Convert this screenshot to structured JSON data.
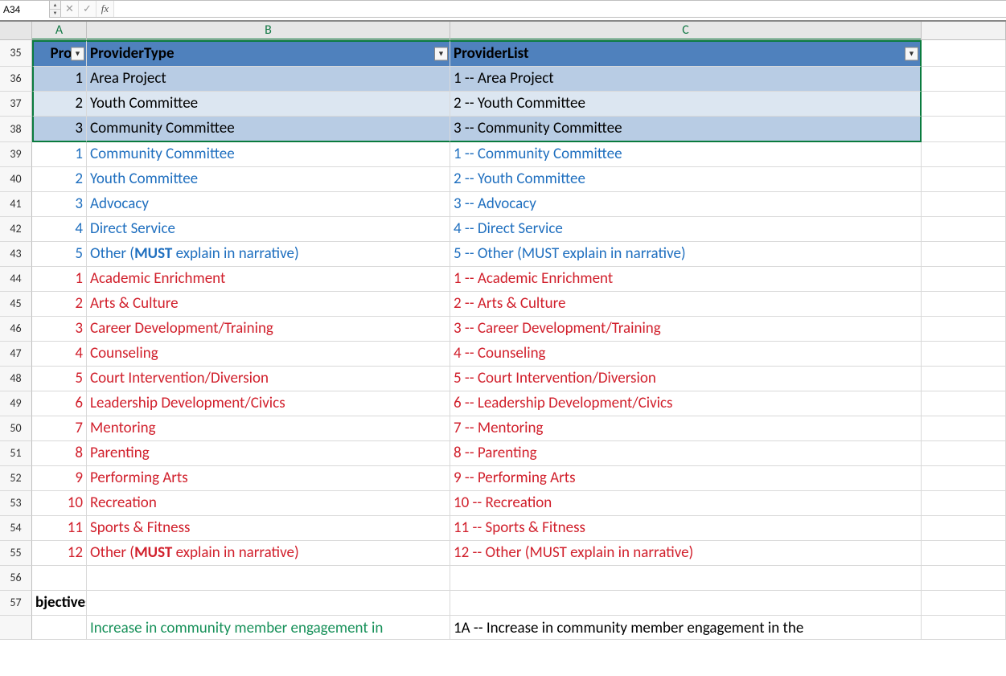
{
  "formula_bar": {
    "name_box": "A34",
    "cancel": "✕",
    "accept": "✓",
    "fx": "fx",
    "formula": ""
  },
  "columns": [
    "A",
    "B",
    "C"
  ],
  "header_row_num": "35",
  "headers": {
    "A": "Provi",
    "B": "ProviderType",
    "C": "ProviderList"
  },
  "rows": [
    {
      "n": "36",
      "style": "band1",
      "a": "1",
      "b": "Area Project",
      "c": "1 -- Area Project",
      "group": "black"
    },
    {
      "n": "37",
      "style": "band2",
      "a": "2",
      "b": "Youth Committee",
      "c": "2 -- Youth Committee",
      "group": "black"
    },
    {
      "n": "38",
      "style": "band1",
      "a": "3",
      "b": "Community Committee",
      "c": "3 -- Community Committee",
      "group": "black"
    },
    {
      "n": "39",
      "style": "",
      "a": "1",
      "b": "Community Committee",
      "c": "1 -- Community Committee",
      "group": "blue"
    },
    {
      "n": "40",
      "style": "",
      "a": "2",
      "b": "Youth Committee",
      "c": "2 -- Youth Committee",
      "group": "blue"
    },
    {
      "n": "41",
      "style": "",
      "a": "3",
      "b": "Advocacy",
      "c": "3 -- Advocacy",
      "group": "blue"
    },
    {
      "n": "42",
      "style": "",
      "a": "4",
      "b": "Direct Service",
      "c": "4 -- Direct Service",
      "group": "blue"
    },
    {
      "n": "43",
      "style": "",
      "a": "5",
      "b_html": "Other (<span class=\"must\">MUST</span> explain in narrative)",
      "c": "5 -- Other (MUST explain in narrative)",
      "group": "blue"
    },
    {
      "n": "44",
      "style": "",
      "a": "1",
      "b": "Academic Enrichment",
      "c": "1 -- Academic Enrichment",
      "group": "red"
    },
    {
      "n": "45",
      "style": "",
      "a": "2",
      "b": "Arts & Culture",
      "c": "2 -- Arts & Culture",
      "group": "red"
    },
    {
      "n": "46",
      "style": "",
      "a": "3",
      "b": "Career Development/Training",
      "c": "3 -- Career Development/Training",
      "group": "red"
    },
    {
      "n": "47",
      "style": "",
      "a": "4",
      "b": "Counseling",
      "c": "4 -- Counseling",
      "group": "red"
    },
    {
      "n": "48",
      "style": "",
      "a": "5",
      "b": "Court Intervention/Diversion",
      "c": "5 -- Court Intervention/Diversion",
      "group": "red"
    },
    {
      "n": "49",
      "style": "",
      "a": "6",
      "b": "Leadership Development/Civics",
      "c": "6 -- Leadership Development/Civics",
      "group": "red"
    },
    {
      "n": "50",
      "style": "",
      "a": "7",
      "b": "Mentoring",
      "c": "7 -- Mentoring",
      "group": "red"
    },
    {
      "n": "51",
      "style": "",
      "a": "8",
      "b": "Parenting",
      "c": "8 -- Parenting",
      "group": "red"
    },
    {
      "n": "52",
      "style": "",
      "a": "9",
      "b": "Performing Arts",
      "c": "9 -- Performing Arts",
      "group": "red"
    },
    {
      "n": "53",
      "style": "",
      "a": "10",
      "b": "Recreation",
      "c": "10 -- Recreation",
      "group": "red"
    },
    {
      "n": "54",
      "style": "",
      "a": "11",
      "b": "Sports & Fitness",
      "c": "11 -- Sports & Fitness",
      "group": "red"
    },
    {
      "n": "55",
      "style": "",
      "a": "12",
      "b_html": "Other (<span class=\"must\">MUST</span> explain in narrative)",
      "c": "12 -- Other (MUST explain in narrative)",
      "group": "red"
    },
    {
      "n": "56",
      "style": "blank",
      "a": "",
      "b": "",
      "c": "",
      "group": ""
    },
    {
      "n": "57",
      "style": "",
      "a_span": "bjectives",
      "group": "blackbold"
    }
  ],
  "partial_row": {
    "n": "",
    "b": "Increase in community member engagement in",
    "c": "1A -- Increase in community member engagement in the"
  }
}
